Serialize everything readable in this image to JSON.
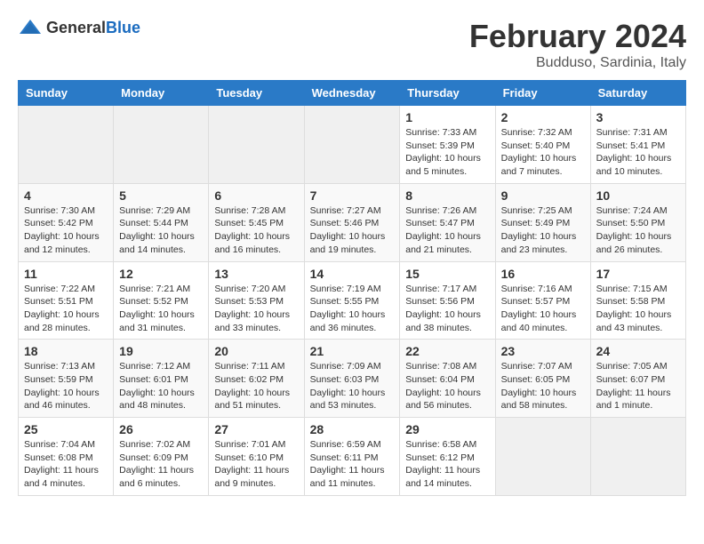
{
  "logo": {
    "general": "General",
    "blue": "Blue"
  },
  "title": "February 2024",
  "subtitle": "Budduso, Sardinia, Italy",
  "days_of_week": [
    "Sunday",
    "Monday",
    "Tuesday",
    "Wednesday",
    "Thursday",
    "Friday",
    "Saturday"
  ],
  "weeks": [
    [
      {
        "day": "",
        "info": ""
      },
      {
        "day": "",
        "info": ""
      },
      {
        "day": "",
        "info": ""
      },
      {
        "day": "",
        "info": ""
      },
      {
        "day": "1",
        "info": "Sunrise: 7:33 AM\nSunset: 5:39 PM\nDaylight: 10 hours\nand 5 minutes."
      },
      {
        "day": "2",
        "info": "Sunrise: 7:32 AM\nSunset: 5:40 PM\nDaylight: 10 hours\nand 7 minutes."
      },
      {
        "day": "3",
        "info": "Sunrise: 7:31 AM\nSunset: 5:41 PM\nDaylight: 10 hours\nand 10 minutes."
      }
    ],
    [
      {
        "day": "4",
        "info": "Sunrise: 7:30 AM\nSunset: 5:42 PM\nDaylight: 10 hours\nand 12 minutes."
      },
      {
        "day": "5",
        "info": "Sunrise: 7:29 AM\nSunset: 5:44 PM\nDaylight: 10 hours\nand 14 minutes."
      },
      {
        "day": "6",
        "info": "Sunrise: 7:28 AM\nSunset: 5:45 PM\nDaylight: 10 hours\nand 16 minutes."
      },
      {
        "day": "7",
        "info": "Sunrise: 7:27 AM\nSunset: 5:46 PM\nDaylight: 10 hours\nand 19 minutes."
      },
      {
        "day": "8",
        "info": "Sunrise: 7:26 AM\nSunset: 5:47 PM\nDaylight: 10 hours\nand 21 minutes."
      },
      {
        "day": "9",
        "info": "Sunrise: 7:25 AM\nSunset: 5:49 PM\nDaylight: 10 hours\nand 23 minutes."
      },
      {
        "day": "10",
        "info": "Sunrise: 7:24 AM\nSunset: 5:50 PM\nDaylight: 10 hours\nand 26 minutes."
      }
    ],
    [
      {
        "day": "11",
        "info": "Sunrise: 7:22 AM\nSunset: 5:51 PM\nDaylight: 10 hours\nand 28 minutes."
      },
      {
        "day": "12",
        "info": "Sunrise: 7:21 AM\nSunset: 5:52 PM\nDaylight: 10 hours\nand 31 minutes."
      },
      {
        "day": "13",
        "info": "Sunrise: 7:20 AM\nSunset: 5:53 PM\nDaylight: 10 hours\nand 33 minutes."
      },
      {
        "day": "14",
        "info": "Sunrise: 7:19 AM\nSunset: 5:55 PM\nDaylight: 10 hours\nand 36 minutes."
      },
      {
        "day": "15",
        "info": "Sunrise: 7:17 AM\nSunset: 5:56 PM\nDaylight: 10 hours\nand 38 minutes."
      },
      {
        "day": "16",
        "info": "Sunrise: 7:16 AM\nSunset: 5:57 PM\nDaylight: 10 hours\nand 40 minutes."
      },
      {
        "day": "17",
        "info": "Sunrise: 7:15 AM\nSunset: 5:58 PM\nDaylight: 10 hours\nand 43 minutes."
      }
    ],
    [
      {
        "day": "18",
        "info": "Sunrise: 7:13 AM\nSunset: 5:59 PM\nDaylight: 10 hours\nand 46 minutes."
      },
      {
        "day": "19",
        "info": "Sunrise: 7:12 AM\nSunset: 6:01 PM\nDaylight: 10 hours\nand 48 minutes."
      },
      {
        "day": "20",
        "info": "Sunrise: 7:11 AM\nSunset: 6:02 PM\nDaylight: 10 hours\nand 51 minutes."
      },
      {
        "day": "21",
        "info": "Sunrise: 7:09 AM\nSunset: 6:03 PM\nDaylight: 10 hours\nand 53 minutes."
      },
      {
        "day": "22",
        "info": "Sunrise: 7:08 AM\nSunset: 6:04 PM\nDaylight: 10 hours\nand 56 minutes."
      },
      {
        "day": "23",
        "info": "Sunrise: 7:07 AM\nSunset: 6:05 PM\nDaylight: 10 hours\nand 58 minutes."
      },
      {
        "day": "24",
        "info": "Sunrise: 7:05 AM\nSunset: 6:07 PM\nDaylight: 11 hours\nand 1 minute."
      }
    ],
    [
      {
        "day": "25",
        "info": "Sunrise: 7:04 AM\nSunset: 6:08 PM\nDaylight: 11 hours\nand 4 minutes."
      },
      {
        "day": "26",
        "info": "Sunrise: 7:02 AM\nSunset: 6:09 PM\nDaylight: 11 hours\nand 6 minutes."
      },
      {
        "day": "27",
        "info": "Sunrise: 7:01 AM\nSunset: 6:10 PM\nDaylight: 11 hours\nand 9 minutes."
      },
      {
        "day": "28",
        "info": "Sunrise: 6:59 AM\nSunset: 6:11 PM\nDaylight: 11 hours\nand 11 minutes."
      },
      {
        "day": "29",
        "info": "Sunrise: 6:58 AM\nSunset: 6:12 PM\nDaylight: 11 hours\nand 14 minutes."
      },
      {
        "day": "",
        "info": ""
      },
      {
        "day": "",
        "info": ""
      }
    ]
  ]
}
